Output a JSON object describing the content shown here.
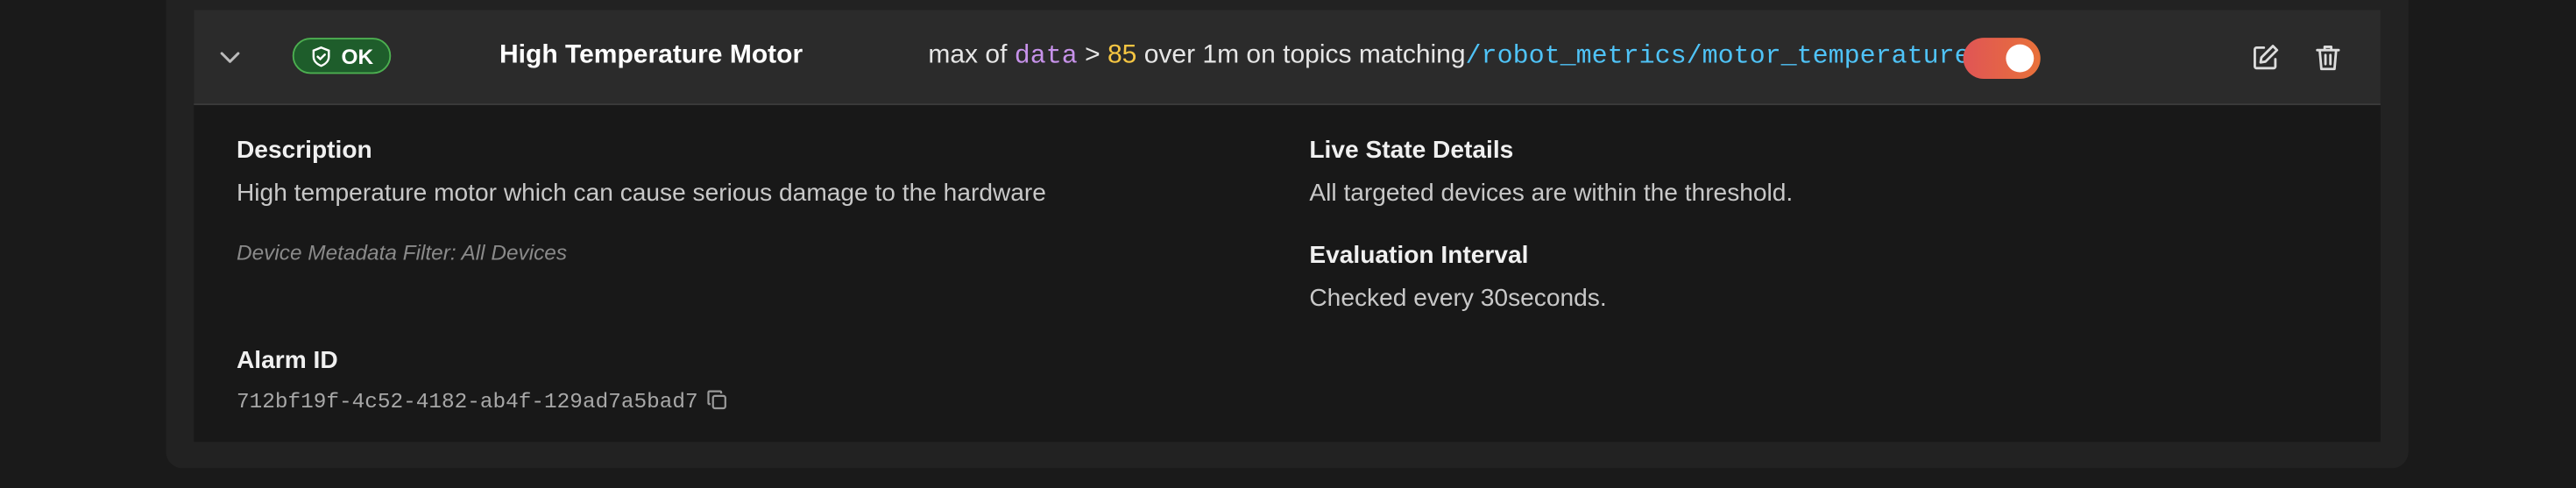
{
  "alarm": {
    "status": "OK",
    "name": "High Temperature Motor",
    "condition": {
      "aggregate": "max of",
      "field": "data",
      "operator": ">",
      "threshold": "85",
      "window_text": "over 1m on topics matching",
      "topic": "/robot_metrics/motor_temperature"
    },
    "enabled": true
  },
  "details": {
    "description_label": "Description",
    "description": "High temperature motor which can cause serious damage to the hardware",
    "metadata_filter": "Device Metadata Filter: All Devices",
    "alarm_id_label": "Alarm ID",
    "alarm_id": "712bf19f-4c52-4182-ab4f-129ad7a5bad7",
    "live_state_label": "Live State Details",
    "live_state": "All targeted devices are within the threshold.",
    "eval_label": "Evaluation Interval",
    "eval_text": "Checked every 30seconds."
  },
  "colors": {
    "ok_badge": "#1e5d2b",
    "toggle_on": "#e8713a",
    "topic": "#4fc3f7",
    "field": "#c792ea",
    "threshold": "#f5c542"
  },
  "icons": [
    "chevron-down-icon",
    "shield-check-icon",
    "edit-icon",
    "trash-icon",
    "copy-icon"
  ]
}
